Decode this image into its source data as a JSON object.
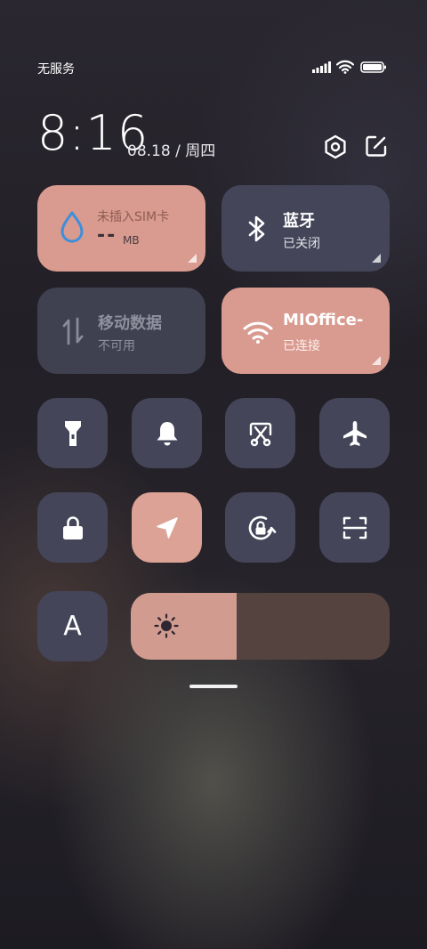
{
  "status_bar": {
    "carrier": "无服务",
    "icons": [
      "signal-icon",
      "wifi-icon",
      "battery-icon"
    ]
  },
  "clock": {
    "time": "8:16",
    "date": "08.18 / 周四"
  },
  "header_buttons": [
    "settings-icon",
    "edit-icon"
  ],
  "tiles": {
    "data_usage": {
      "title": "未插入SIM卡",
      "value": "--",
      "unit": "MB",
      "icon": "water-drop-icon"
    },
    "bluetooth": {
      "title": "蓝牙",
      "status": "已关闭",
      "icon": "bluetooth-icon"
    },
    "mobile_data": {
      "title": "移动数据",
      "status": "不可用",
      "icon": "data-arrows-icon"
    },
    "wifi": {
      "title": "MIOffice-",
      "status": "已连接",
      "icon": "wifi-icon"
    }
  },
  "toggles_row1": [
    "flashlight-icon",
    "bell-icon",
    "screenshot-icon",
    "airplane-icon"
  ],
  "toggles_row2": [
    "lock-icon",
    "location-icon",
    "rotation-lock-icon",
    "scan-icon"
  ],
  "font_button": {
    "label": "A"
  },
  "brightness": {
    "level": 0.41,
    "icon": "sun-icon"
  },
  "colors": {
    "accent": "#d99a8f",
    "tile": "#444559"
  }
}
